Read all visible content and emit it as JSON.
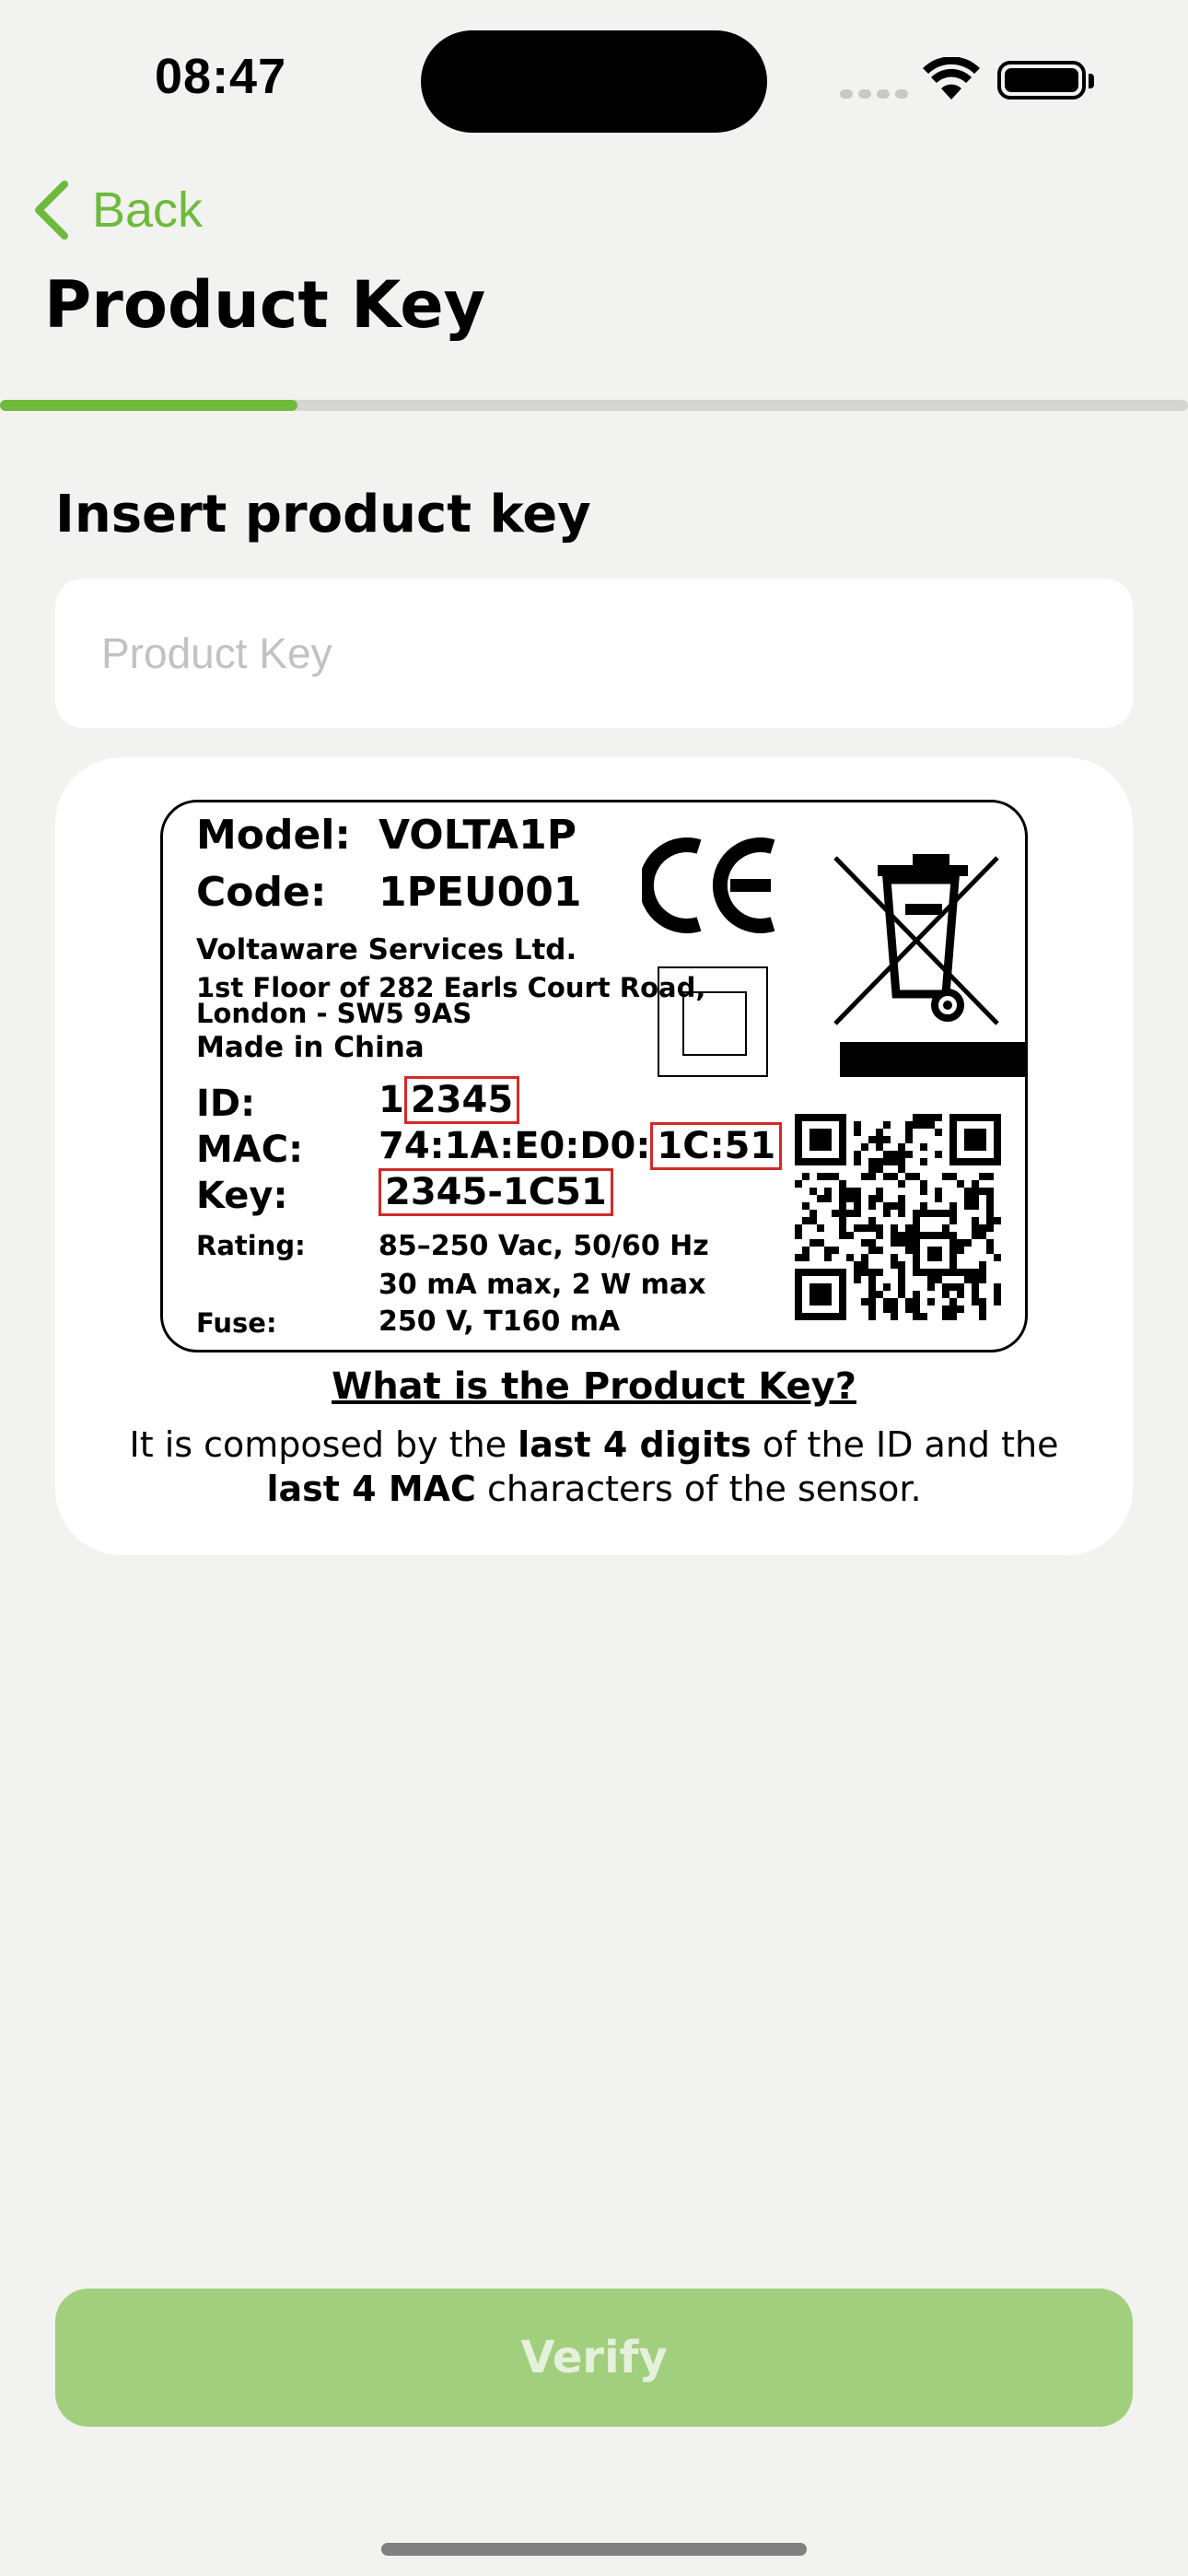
{
  "status_bar": {
    "time": "08:47"
  },
  "nav": {
    "back_label": "Back",
    "title": "Product Key"
  },
  "progress": {
    "fraction": 0.25
  },
  "form": {
    "heading": "Insert product key",
    "input_value": "",
    "input_placeholder": "Product Key"
  },
  "label": {
    "model_label": "Model:",
    "model_value": "VOLTA1P",
    "code_label": "Code:",
    "code_value": "1PEU001",
    "company": "Voltaware Services Ltd.",
    "address_line1": "1st Floor of 282 Earls Court Road,",
    "address_line2": "London - SW5 9AS",
    "made_in": "Made in China",
    "id_label": "ID:",
    "id_prefix": "1",
    "id_highlight": "2345",
    "mac_label": "MAC:",
    "mac_prefix": "74:1A:E0:D0:",
    "mac_highlight": "1C:51",
    "key_label": "Key:",
    "key_value": "2345-1C51",
    "rating_label": "Rating:",
    "rating_line1": "85–250 Vac, 50/60 Hz",
    "rating_line2": "30 mA max, 2 W max",
    "fuse_label": "Fuse:",
    "fuse_value": "250 V, T160 mA"
  },
  "help": {
    "title": "What is the Product Key?",
    "text_1": "It is composed by the ",
    "bold_1": "last 4 digits",
    "text_2": " of the ID and the ",
    "bold_2": "last 4 MAC",
    "text_3": " characters of the sensor."
  },
  "verify_label": "Verify",
  "colors": {
    "accent": "#6fba3c",
    "button_disabled": "#a2cf7e",
    "highlight_box": "#d22a2a"
  }
}
